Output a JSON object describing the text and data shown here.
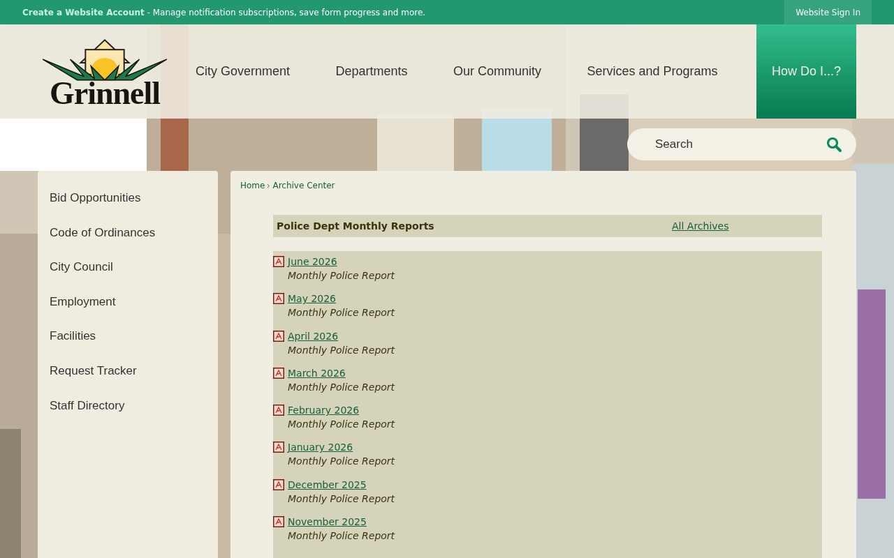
{
  "top_bar": {
    "account_link": "Create a Website Account",
    "message": " - Manage notification subscriptions, save form progress and more.",
    "sign_in": "Website Sign In"
  },
  "logo": {
    "text": "Grinnell"
  },
  "nav": [
    {
      "label": "City Government",
      "selected": false
    },
    {
      "label": "Departments",
      "selected": false
    },
    {
      "label": "Our Community",
      "selected": false
    },
    {
      "label": "Services and Programs",
      "selected": false
    },
    {
      "label": "How Do I...?",
      "selected": true
    }
  ],
  "search": {
    "placeholder": "Search"
  },
  "sidebar": {
    "items": [
      "Bid Opportunities",
      "Code of Ordinances",
      "City Council",
      "Employment",
      "Facilities",
      "Request Tracker",
      "Staff Directory"
    ]
  },
  "breadcrumb": [
    "Home",
    "Archive Center"
  ],
  "archive": {
    "title": "Police Dept Monthly Reports",
    "all_link": "All Archives",
    "items": [
      {
        "title": "June 2026",
        "description": "Monthly Police Report"
      },
      {
        "title": "May 2026",
        "description": "Monthly Police Report"
      },
      {
        "title": "April 2026",
        "description": "Monthly Police Report"
      },
      {
        "title": "March 2026",
        "description": "Monthly Police Report"
      },
      {
        "title": "February 2026",
        "description": "Monthly Police Report"
      },
      {
        "title": "January 2026",
        "description": "Monthly Police Report"
      },
      {
        "title": "December 2025",
        "description": "Monthly Police Report"
      },
      {
        "title": "November 2025",
        "description": "Monthly Police Report"
      }
    ]
  }
}
